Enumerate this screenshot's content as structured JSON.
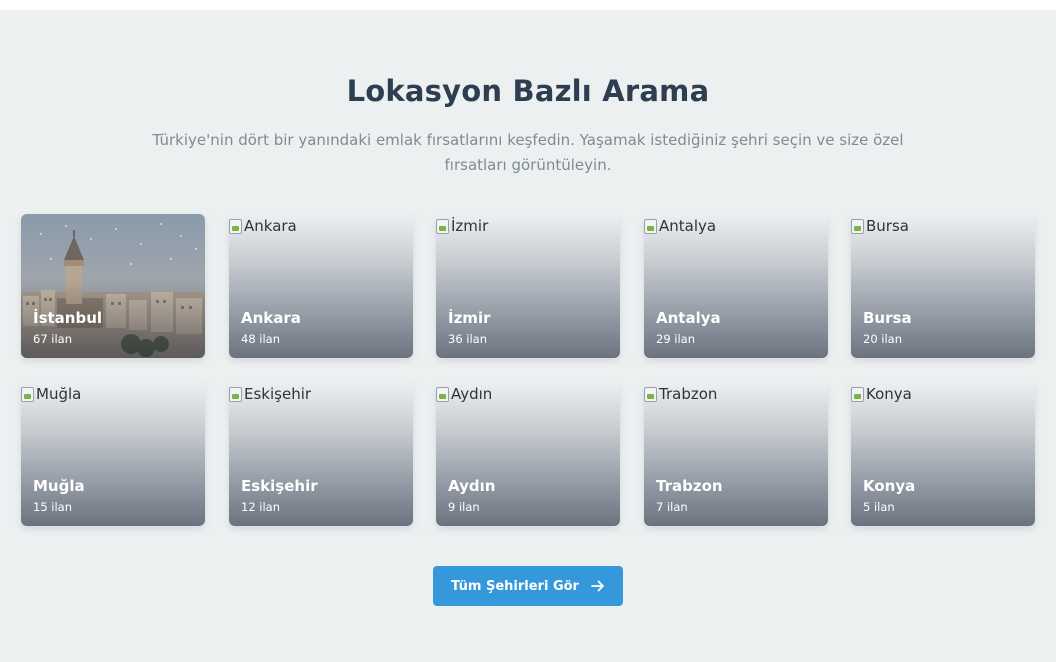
{
  "header": {
    "title": "Lokasyon Bazlı Arama",
    "subtitle": "Türkiye'nin dört bir yanındaki emlak fırsatlarını keşfedin. Yaşamak istediğiniz şehri seçin ve size özel fırsatları görüntüleyin."
  },
  "cities": [
    {
      "name": "İstanbul",
      "count": "67 ilan",
      "alt": "",
      "has_photo": true
    },
    {
      "name": "Ankara",
      "count": "48 ilan",
      "alt": "Ankara"
    },
    {
      "name": "İzmir",
      "count": "36 ilan",
      "alt": "İzmir"
    },
    {
      "name": "Antalya",
      "count": "29 ilan",
      "alt": "Antalya"
    },
    {
      "name": "Bursa",
      "count": "20 ilan",
      "alt": "Bursa"
    },
    {
      "name": "Muğla",
      "count": "15 ilan",
      "alt": "Muğla"
    },
    {
      "name": "Eskişehir",
      "count": "12 ilan",
      "alt": "Eskişehir"
    },
    {
      "name": "Aydın",
      "count": "9 ilan",
      "alt": "Aydın"
    },
    {
      "name": "Trabzon",
      "count": "7 ilan",
      "alt": "Trabzon"
    },
    {
      "name": "Konya",
      "count": "5 ilan",
      "alt": "Konya"
    }
  ],
  "cta": {
    "label": "Tüm Şehirleri Gör",
    "icon": "arrow-right-icon"
  },
  "colors": {
    "background": "#ecf0f1",
    "title": "#2c3e50",
    "subtitle": "#7f8c8d",
    "accent": "#3498db"
  }
}
